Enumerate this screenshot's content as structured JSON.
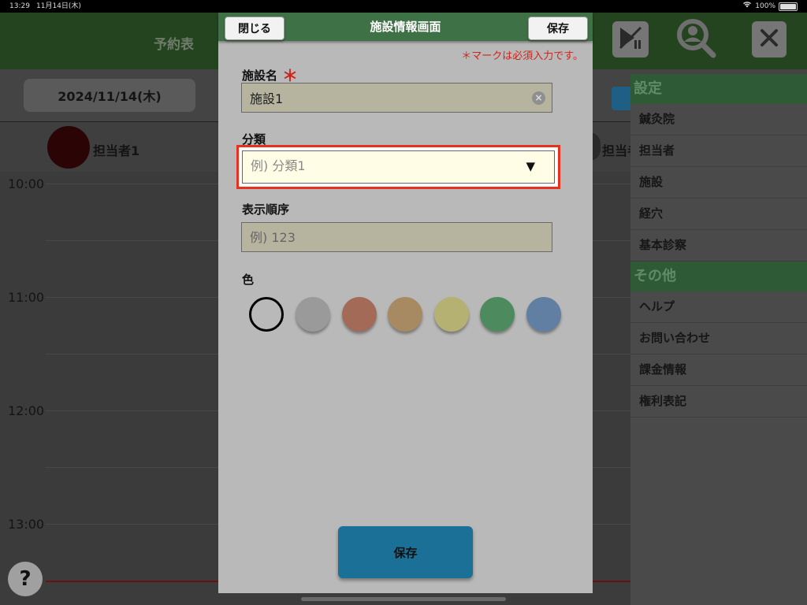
{
  "status_bar": {
    "time": "13:29",
    "date": "11月14日(木)",
    "battery": "100%"
  },
  "background": {
    "title": "予約表",
    "date_button": "2024/11/14(木)",
    "staff": [
      "担当者1",
      "担当者"
    ],
    "times": [
      "10:00",
      "11:00",
      "12:00",
      "13:00"
    ],
    "help": "?"
  },
  "side_panel": {
    "sections": [
      {
        "header": "設定",
        "items": [
          "鍼灸院",
          "担当者",
          "施設",
          "経穴",
          "基本診察"
        ]
      },
      {
        "header": "その他",
        "items": [
          "ヘルプ",
          "お問い合わせ",
          "課金情報",
          "権利表記"
        ]
      }
    ]
  },
  "modal": {
    "title": "施設情報画面",
    "close_label": "閉じる",
    "save_label": "保存",
    "required_note": "＊マークは必須入力です。",
    "name_label": "施設名",
    "required_mark": "＊",
    "name_value": "施設1",
    "category_label": "分類",
    "category_placeholder": "例) 分類1",
    "order_label": "表示順序",
    "order_placeholder": "例) 123",
    "color_label": "色",
    "colors": [
      "none",
      "#9a9a9a",
      "#a46a58",
      "#a88a62",
      "#b5b172",
      "#4d8b5f",
      "#617fa2"
    ],
    "bottom_save_label": "保存"
  }
}
